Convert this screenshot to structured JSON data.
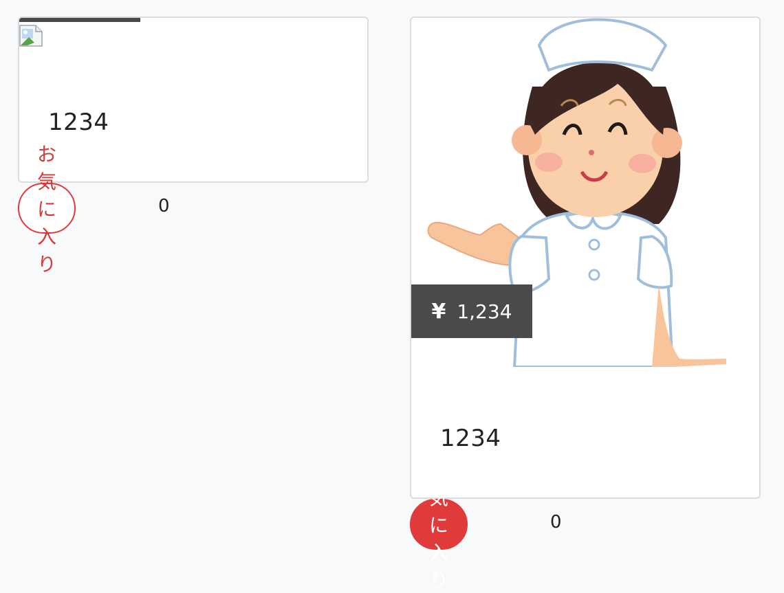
{
  "products": [
    {
      "image_state": "broken-image-icon",
      "number": "1234",
      "favorite_label": "お気に入り",
      "favorite_count": "0",
      "favorite_active": false
    },
    {
      "image_state": "nurse-illustration",
      "price_symbol": "¥",
      "price": "1,234",
      "number": "1234",
      "favorite_label": "お気に入り",
      "favorite_count": "0",
      "favorite_active": true
    }
  ],
  "colors": {
    "background": "#f8f9fb",
    "card_border": "#dcdcdc",
    "price_tag": "#4a4a4a",
    "favorite_red": "#e03a3a"
  }
}
